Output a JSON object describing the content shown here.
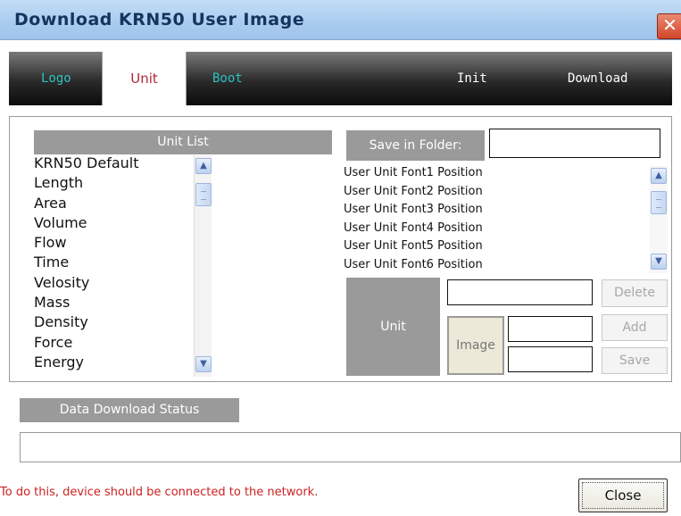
{
  "window": {
    "title": "Download KRN50 User Image",
    "close_glyph": "✕"
  },
  "tabs": [
    {
      "label": "Logo",
      "color": "#2ec3c0"
    },
    {
      "label": "Unit",
      "color": "#b0283a"
    },
    {
      "label": "Boot",
      "color": "#2ec3c0"
    },
    {
      "label": "Init",
      "color": "#ffffff"
    },
    {
      "label": "Download",
      "color": "#ffffff"
    }
  ],
  "unit_list": {
    "header": "Unit List",
    "items": [
      "KRN50 Default",
      "Length",
      "Area",
      "Volume",
      "Flow",
      "Time",
      "Velosity",
      "Mass",
      "Density",
      "Force",
      "Energy"
    ]
  },
  "save_folder": {
    "label": "Save in Folder:",
    "value": ""
  },
  "positions": [
    "User Unit Font1 Position",
    "User Unit Font2 Position",
    "User Unit Font3 Position",
    "User Unit Font4 Position",
    "User Unit Font5 Position",
    "User Unit Font6 Position"
  ],
  "unit_editor": {
    "unit_label": "Unit",
    "image_label": "Image",
    "unit_value": "",
    "image_value_1": "",
    "image_value_2": "",
    "delete_label": "Delete",
    "add_label": "Add",
    "save_label": "Save"
  },
  "status": {
    "header": "Data Download Status",
    "value": ""
  },
  "footer": {
    "note": "To do this, device should be connected to the network.",
    "close_label": "Close"
  },
  "scroll_glyphs": {
    "up": "▲",
    "down": "▼"
  },
  "colors": {
    "title_bar": "#a9cbef",
    "close_red": "#d2452a",
    "header_gray": "#9a9a9a",
    "note_red": "#cc2222",
    "active_tab_text": "#b0283a",
    "inactive_tab_text": "#2ec3c0"
  }
}
